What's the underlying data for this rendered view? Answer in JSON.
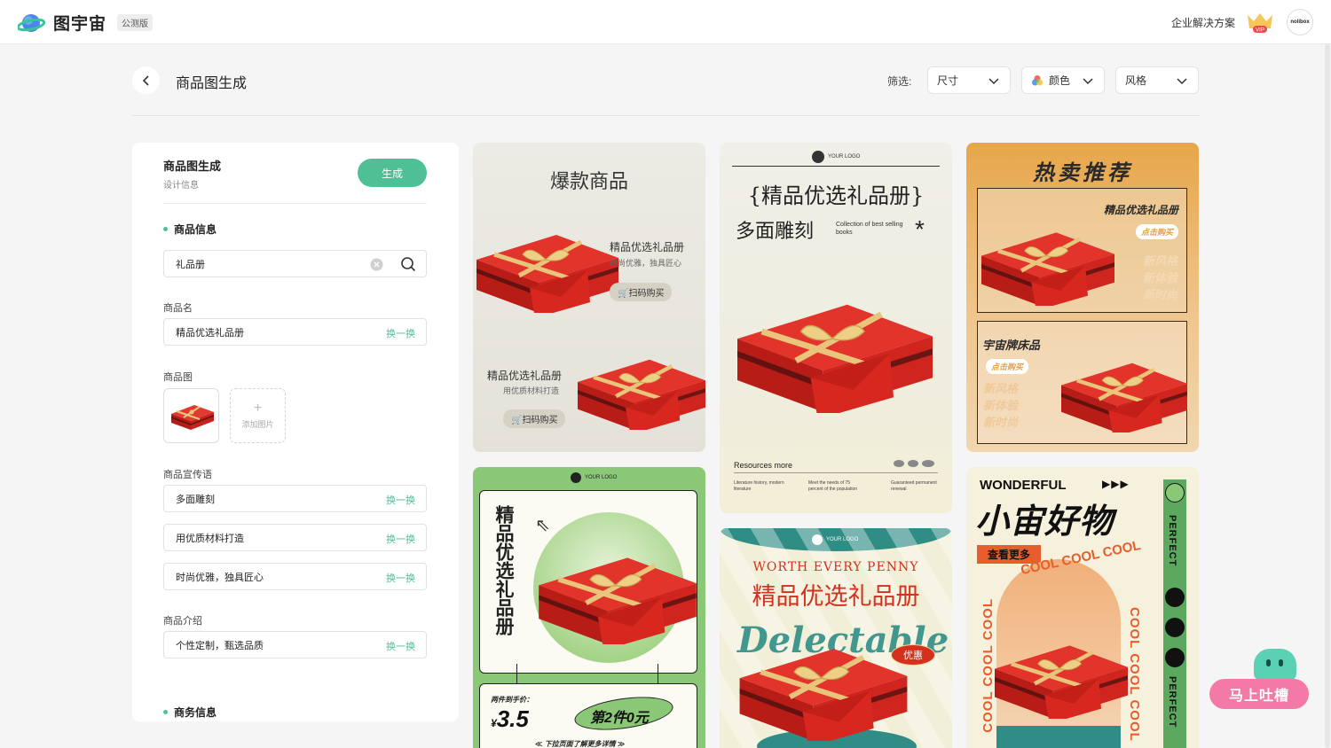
{
  "colors": {
    "accent": "#4fbf95",
    "red": "#d9231f"
  },
  "app": {
    "name": "图宇宙",
    "badge": "公测版"
  },
  "nav": {
    "enterprise": "企业解决方案",
    "vip_label": "VIP",
    "avatar_text": "nolibox"
  },
  "header": {
    "title": "商品图生成",
    "filter_label": "筛选:"
  },
  "filters": [
    {
      "label": "尺寸",
      "icon": ""
    },
    {
      "label": "颜色",
      "icon": "color-wheel-icon"
    },
    {
      "label": "风格",
      "icon": ""
    }
  ],
  "panel": {
    "title": "商品图生成",
    "subtitle": "设计信息",
    "generate_label": "生成",
    "product_info_title": "商品信息",
    "search_value": "礼品册",
    "name_label": "商品名",
    "name_value": "精品优选礼品册",
    "image_label": "商品图",
    "add_image_label": "添加图片",
    "slogan_label": "商品宣传语",
    "slogans": [
      "多面雕刻",
      "用优质材料打造",
      "时尚优雅，独具匠心"
    ],
    "intro_label": "商品介绍",
    "intro_value": "个性定制，甄选品质",
    "business_title": "商务信息",
    "swap_label": "换一换"
  },
  "cards": {
    "c1": {
      "title": "爆款商品",
      "name": "精品优选礼品册",
      "desc": "时尚优雅，独具匠心",
      "buy": "扫码购买",
      "name2": "精品优选礼品册",
      "desc2": "用优质材料打造",
      "buy2": "扫码购买"
    },
    "c2": {
      "logo": "YOUR LOGO",
      "title": "{精品优选礼品册}",
      "sub": "多面雕刻",
      "en": "Collection of best selling books",
      "resources": "Resources more",
      "col1": "Literature history, modern literature",
      "col2": "Meet the needs of 75 percent of the population",
      "col3": "Guaranteed permanent renewal"
    },
    "c3": {
      "title": "热卖推荐",
      "box1_title": "精品优选礼品册",
      "buy": "点击购买",
      "lines": [
        "新风格",
        "新体验",
        "新时尚"
      ],
      "box2_title": "宇宙牌床品",
      "buy2": "点击购买"
    },
    "c4": {
      "logo": "YOUR LOGO",
      "vtitle": "精品优选礼品册",
      "price_label": "两件到手价：",
      "currency": "¥",
      "price": "3.5",
      "deal": "第2件0元",
      "hint": "下拉页面了解更多详情"
    },
    "c5": {
      "logo": "YOUR LOGO",
      "en": "WORTH EVERY PENNY",
      "title": "精品优选礼品册",
      "script": "Delectable",
      "badge": "优惠"
    },
    "c6": {
      "brand": "WONDERFUL",
      "title": "小宙好物",
      "more": "查看更多",
      "cool": "COOL COOL COOL",
      "perfect": "PERFECT"
    }
  },
  "feedback": {
    "label": "马上吐槽"
  }
}
